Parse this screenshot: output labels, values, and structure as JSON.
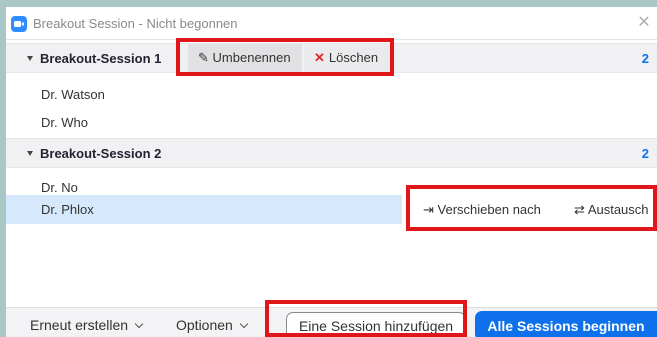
{
  "window": {
    "title": "Breakout Session - Nicht begonnen"
  },
  "sessions": [
    {
      "name": "Breakout-Session 1",
      "count": "2",
      "members": [
        "Dr. Watson",
        "Dr. Who"
      ],
      "actions": {
        "rename": "Umbenennen",
        "delete": "Löschen"
      }
    },
    {
      "name": "Breakout-Session 2",
      "count": "2",
      "members": [
        "Dr. No",
        "Dr. Phlox"
      ],
      "selected_member": "Dr. Phlox",
      "member_actions": {
        "move": "Verschieben nach",
        "swap": "Austausch"
      }
    }
  ],
  "footer": {
    "recreate": "Erneut erstellen",
    "options": "Optionen",
    "add_session": "Eine Session hinzufügen",
    "start_all": "Alle Sessions beginnen"
  },
  "colors": {
    "accent": "#0e71eb",
    "highlight": "#e0161b",
    "selected_row": "#d6e8fb",
    "group_bg": "#f1f1f3"
  },
  "icons": [
    "zoom-app-icon",
    "close-icon",
    "caret-down-icon",
    "pencil-icon",
    "x-icon",
    "move-arrow-icon",
    "swap-arrows-icon",
    "chevron-down-icon"
  ]
}
